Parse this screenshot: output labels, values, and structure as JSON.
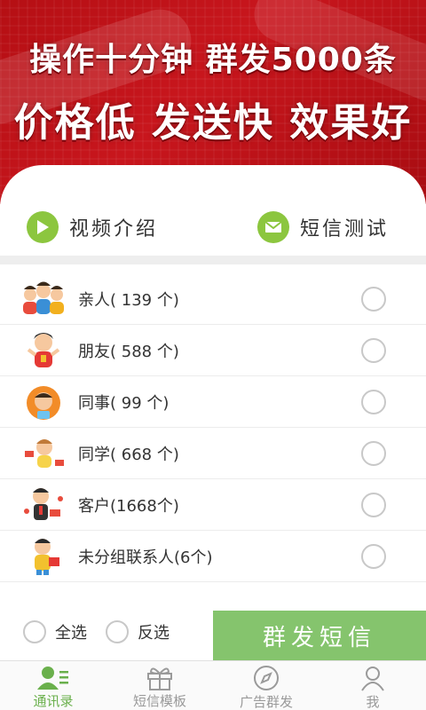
{
  "banner": {
    "line1": "操作十分钟  群发5000条",
    "line2": "价格低  发送快  效果好"
  },
  "actions": {
    "video": {
      "label": "视频介绍",
      "icon": "play-icon"
    },
    "sms_test": {
      "label": "短信测试",
      "icon": "envelope-icon"
    }
  },
  "groups": [
    {
      "label": "亲人( 139 个)",
      "icon": "family-avatar"
    },
    {
      "label": "朋友( 588 个)",
      "icon": "friend-avatar"
    },
    {
      "label": "同事(  99 个)",
      "icon": "colleague-avatar"
    },
    {
      "label": "同学( 668 个)",
      "icon": "classmate-avatar"
    },
    {
      "label": "客户(1668个)",
      "icon": "customer-avatar"
    },
    {
      "label": "未分组联系人(6个)",
      "icon": "ungrouped-avatar"
    }
  ],
  "bottom": {
    "select_all": "全选",
    "invert": "反选",
    "send": "群发短信"
  },
  "tabs": [
    {
      "label": "通讯录",
      "icon": "contacts-icon",
      "active": true
    },
    {
      "label": "短信模板",
      "icon": "gift-icon",
      "active": false
    },
    {
      "label": "广告群发",
      "icon": "compass-icon",
      "active": false
    },
    {
      "label": "我",
      "icon": "user-icon",
      "active": false
    }
  ],
  "colors": {
    "banner_red": "#c8161d",
    "accent_green": "#8cc63f",
    "send_button": "#85c46d",
    "active_tab": "#6ab04c"
  }
}
